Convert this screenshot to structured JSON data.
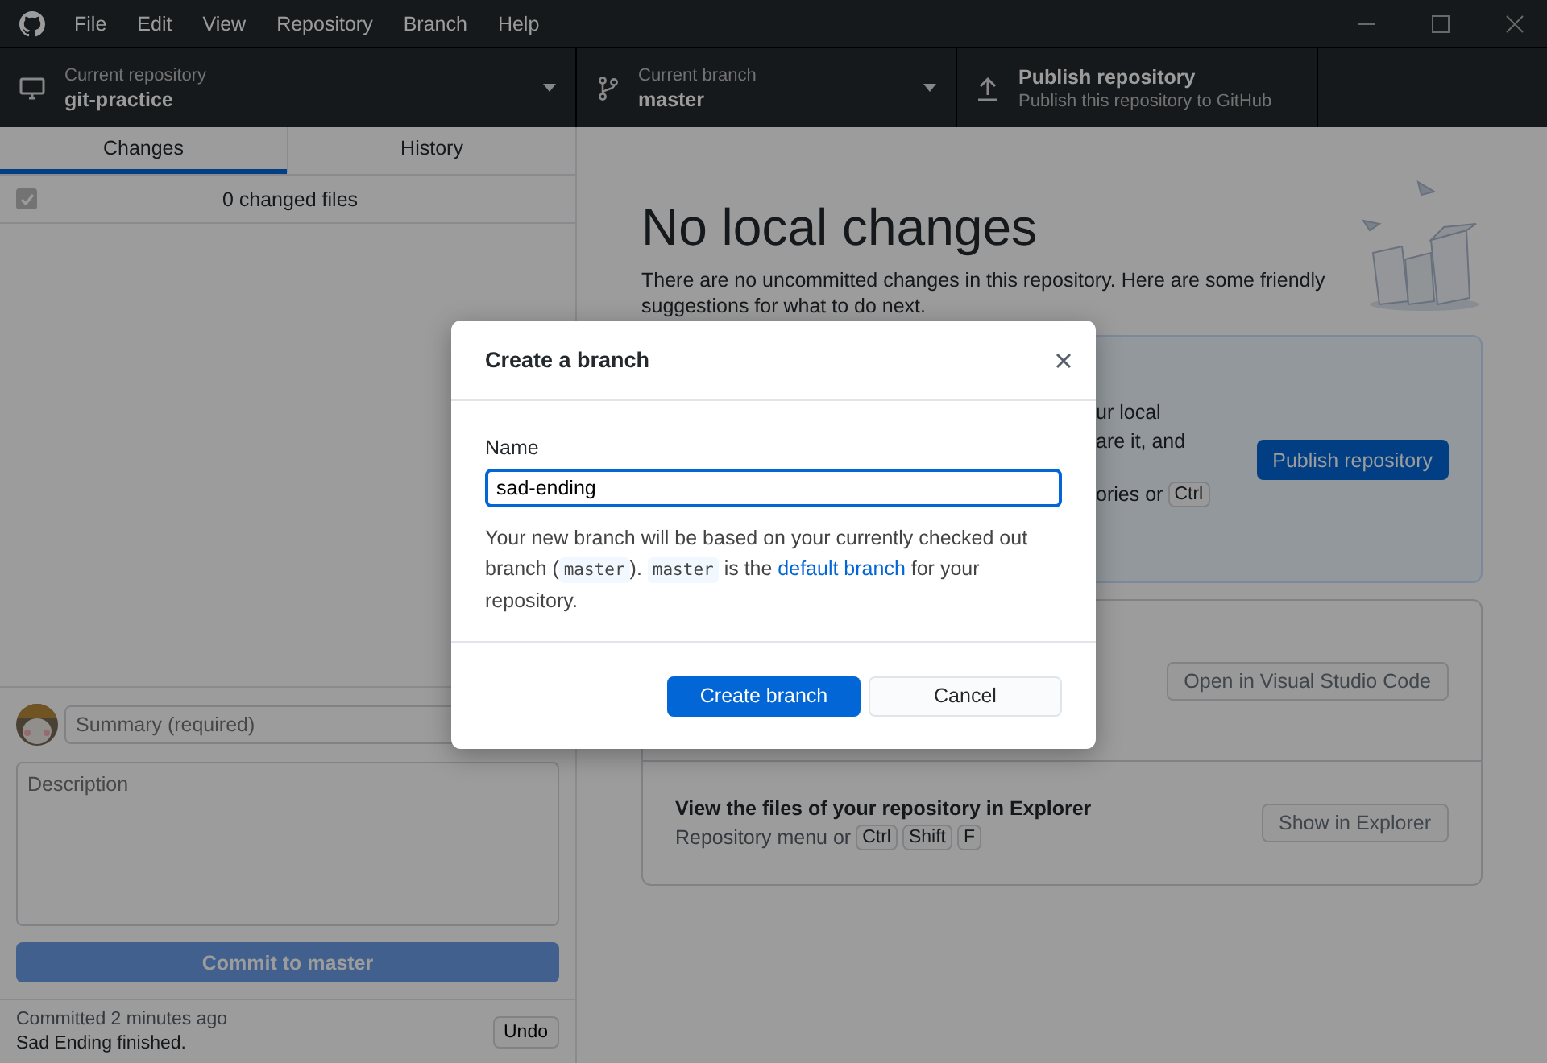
{
  "window": {
    "menu": [
      "File",
      "Edit",
      "View",
      "Repository",
      "Branch",
      "Help"
    ]
  },
  "toolbar": [
    {
      "kind": "repository",
      "label": "Current repository",
      "value": "git-practice"
    },
    {
      "kind": "branch",
      "label": "Current branch",
      "value": "master"
    },
    {
      "kind": "publish",
      "label": "Publish repository",
      "value": "Publish this repository to GitHub"
    }
  ],
  "sidebar": {
    "tabs": [
      {
        "label": "Changes",
        "selected": true
      },
      {
        "label": "History",
        "selected": false
      }
    ],
    "changes": {
      "checked": true,
      "count": "0 changed files"
    },
    "commit": {
      "summary_placeholder": "Summary (required)",
      "description_placeholder": "Description",
      "button": "Commit to master"
    },
    "last_commit": {
      "time": "Committed 2 minutes ago",
      "message": "Sad Ending finished.",
      "undo": "Undo"
    }
  },
  "main": {
    "title": "No local changes",
    "intro": "There are no uncommitted changes in this repository. Here are some friendly suggestions for what to do next.",
    "publish_card": {
      "lines": [
        "ur local",
        "are it, and"
      ],
      "shortcut_text": "ories or",
      "keys": [
        "Ctrl"
      ],
      "button": "Publish repository"
    },
    "editor_card": {
      "button": "Open in Visual Studio Code"
    },
    "explorer_card": {
      "title": "View the files of your repository in Explorer",
      "text": "Repository menu or",
      "keys": [
        "Ctrl",
        "Shift",
        "F"
      ],
      "button": "Show in Explorer"
    }
  },
  "dialog": {
    "title": "Create a branch",
    "field_label": "Name",
    "value": "sad-ending",
    "help": [
      {
        "kind": "text",
        "text": "Your new branch will be based on your currently checked out branch ("
      },
      {
        "kind": "code",
        "text": "master"
      },
      {
        "kind": "text",
        "text": "). "
      },
      {
        "kind": "code",
        "text": "master"
      },
      {
        "kind": "text",
        "text": " is the "
      },
      {
        "kind": "link",
        "text": "default branch"
      },
      {
        "kind": "text",
        "text": " for your repository."
      }
    ],
    "primary": "Create branch",
    "secondary": "Cancel"
  }
}
